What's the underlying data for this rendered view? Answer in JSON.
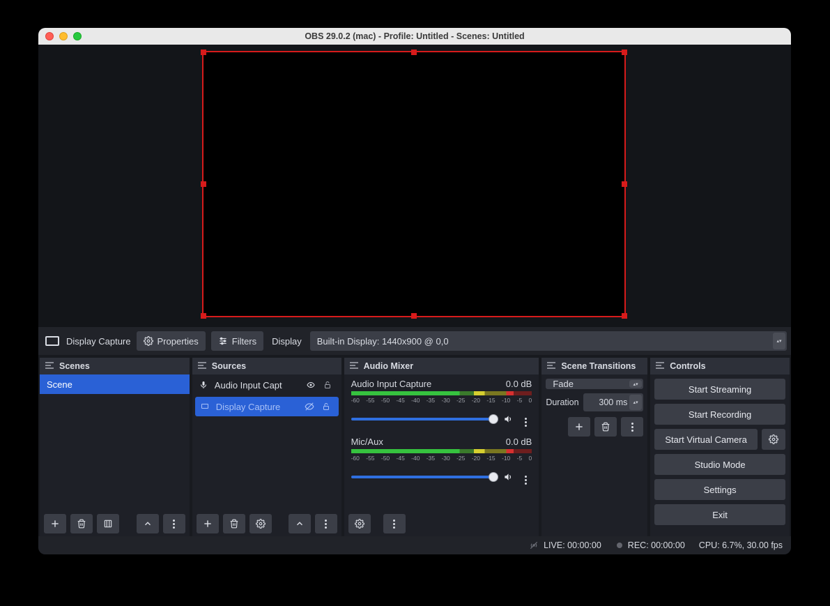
{
  "window": {
    "title": "OBS 29.0.2 (mac) - Profile: Untitled - Scenes: Untitled"
  },
  "source_toolbar": {
    "selected_source": "Display Capture",
    "properties_label": "Properties",
    "filters_label": "Filters",
    "field_label": "Display",
    "display_value": "Built-in Display: 1440x900 @ 0,0"
  },
  "scenes": {
    "title": "Scenes",
    "items": [
      "Scene"
    ]
  },
  "sources": {
    "title": "Sources",
    "items": [
      {
        "label": "Audio Input Capt",
        "icon": "mic",
        "visible": true,
        "locked": false,
        "selected": false
      },
      {
        "label": "Display Capture",
        "icon": "display",
        "visible": false,
        "locked": false,
        "selected": true
      }
    ]
  },
  "mixer": {
    "title": "Audio Mixer",
    "ticks": [
      "-60",
      "-55",
      "-50",
      "-45",
      "-40",
      "-35",
      "-30",
      "-25",
      "-20",
      "-15",
      "-10",
      "-5",
      "0"
    ],
    "channels": [
      {
        "name": "Audio Input Capture",
        "db": "0.0 dB"
      },
      {
        "name": "Mic/Aux",
        "db": "0.0 dB"
      }
    ]
  },
  "transitions": {
    "title": "Scene Transitions",
    "selected": "Fade",
    "duration_label": "Duration",
    "duration_value": "300 ms"
  },
  "controls": {
    "title": "Controls",
    "start_streaming": "Start Streaming",
    "start_recording": "Start Recording",
    "start_virtual_camera": "Start Virtual Camera",
    "studio_mode": "Studio Mode",
    "settings": "Settings",
    "exit": "Exit"
  },
  "statusbar": {
    "live": "LIVE: 00:00:00",
    "rec": "REC: 00:00:00",
    "cpu": "CPU: 6.7%, 30.00 fps"
  }
}
